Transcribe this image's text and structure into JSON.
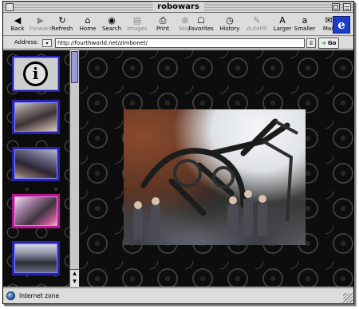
{
  "window": {
    "title": "robowars"
  },
  "toolbar": {
    "buttons": [
      {
        "label": "Back",
        "icon": "back-arrow-icon",
        "glyph": "◀",
        "enabled": true
      },
      {
        "label": "Forward",
        "icon": "forward-arrow-icon",
        "glyph": "▶",
        "enabled": false
      },
      {
        "label": "Refresh",
        "icon": "refresh-icon",
        "glyph": "↻",
        "enabled": true
      },
      {
        "label": "Home",
        "icon": "home-icon",
        "glyph": "⌂",
        "enabled": true
      },
      {
        "label": "Search",
        "icon": "search-icon",
        "glyph": "◉",
        "enabled": true
      },
      {
        "label": "Images",
        "icon": "images-icon",
        "glyph": "▤",
        "enabled": false
      },
      {
        "label": "Print",
        "icon": "print-icon",
        "glyph": "⎙",
        "enabled": true
      },
      {
        "label": "Stop",
        "icon": "stop-icon",
        "glyph": "⊗",
        "enabled": false
      },
      {
        "label": "Favorites",
        "icon": "favorites-icon",
        "glyph": "☖",
        "enabled": true
      },
      {
        "label": "History",
        "icon": "history-icon",
        "glyph": "◷",
        "enabled": true
      },
      {
        "label": "AutoFill",
        "icon": "autofill-icon",
        "glyph": "✎",
        "enabled": false
      },
      {
        "label": "Larger",
        "icon": "larger-text-icon",
        "glyph": "A",
        "enabled": true
      },
      {
        "label": "Smaller",
        "icon": "smaller-text-icon",
        "glyph": "a",
        "enabled": true
      },
      {
        "label": "Mail",
        "icon": "mail-icon",
        "glyph": "✉",
        "enabled": true
      }
    ],
    "logo_glyph": "e"
  },
  "address": {
    "label": "Address:",
    "value": "http://fourthworld.net/zimbonet/",
    "go_label": "Go",
    "go_arrow": "➜"
  },
  "sidebar": {
    "info_glyph": "i",
    "thumbnails": [
      "robot-photo-1",
      "robot-photo-2",
      "robot-photo-3",
      "robot-photo-4"
    ]
  },
  "status": {
    "zone": "Internet zone"
  },
  "colors": {
    "thumb_border": "#2424b0",
    "thumb_border_selected": "#b11891",
    "scroll_thumb": "#9b9bd8",
    "background_pattern": "#0d0d0d"
  }
}
